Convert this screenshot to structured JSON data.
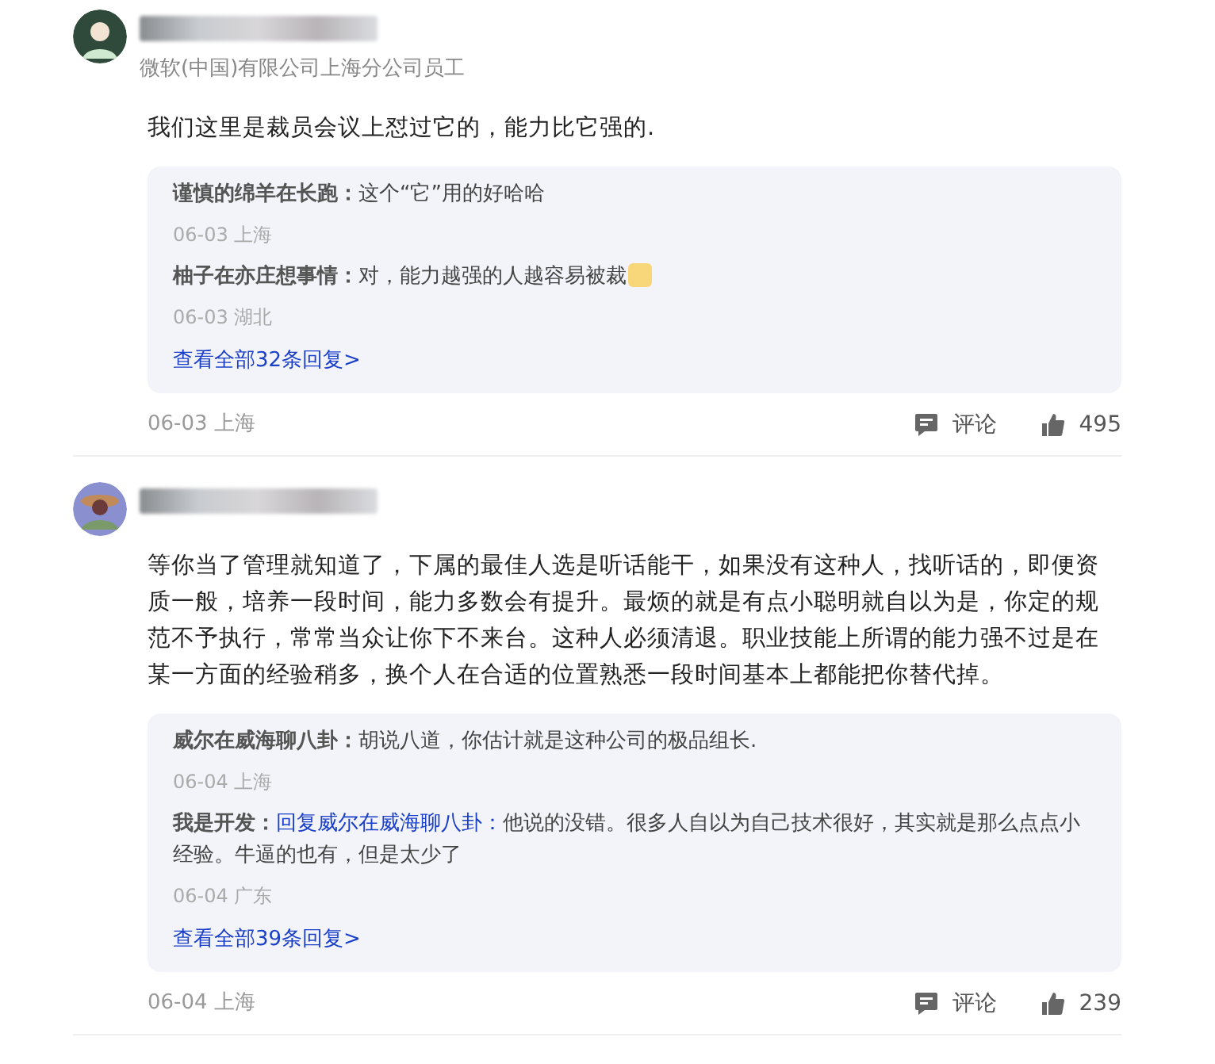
{
  "comments": [
    {
      "subtitle": "微软(中国)有限公司上海分公司员工",
      "text": "我们这里是裁员会议上怼过它的，能力比它强的.",
      "replies": [
        {
          "author": "谨慎的绵羊在长跑：",
          "text": "这个“它”用的好哈哈",
          "emoji": false,
          "meta": "06-03 上海"
        },
        {
          "author": "柚子在亦庄想事情：",
          "text": "对，能力越强的人越容易被裁",
          "emoji": true,
          "meta": "06-03 湖北"
        }
      ],
      "more": "查看全部32条回复>",
      "meta": "06-03 上海",
      "comment_label": "评论",
      "likes": "495"
    },
    {
      "text": "等你当了管理就知道了，下属的最佳人选是听话能干，如果没有这种人，找听话的，即便资质一般，培养一段时间，能力多数会有提升。最烦的就是有点小聪明就自以为是，你定的规范不予执行，常常当众让你下不来台。这种人必须清退。职业技能上所谓的能力强不过是在某一方面的经验稍多，换个人在合适的位置熟悉一段时间基本上都能把你替代掉。",
      "replies": [
        {
          "author": "威尔在威海聊八卦：",
          "text": "胡说八道，你估计就是这种公司的极品组长.",
          "emoji": false,
          "meta": "06-04 上海"
        },
        {
          "author": "我是开发：",
          "reply_to": "回复威尔在威海聊八卦：",
          "text": "他说的没错。很多人自以为自己技术很好，其实就是那么点点小经验。牛逼的也有，但是太少了",
          "emoji": false,
          "meta": "06-04 广东"
        }
      ],
      "more": "查看全部39条回复>",
      "meta": "06-04 上海",
      "comment_label": "评论",
      "likes": "239"
    }
  ]
}
